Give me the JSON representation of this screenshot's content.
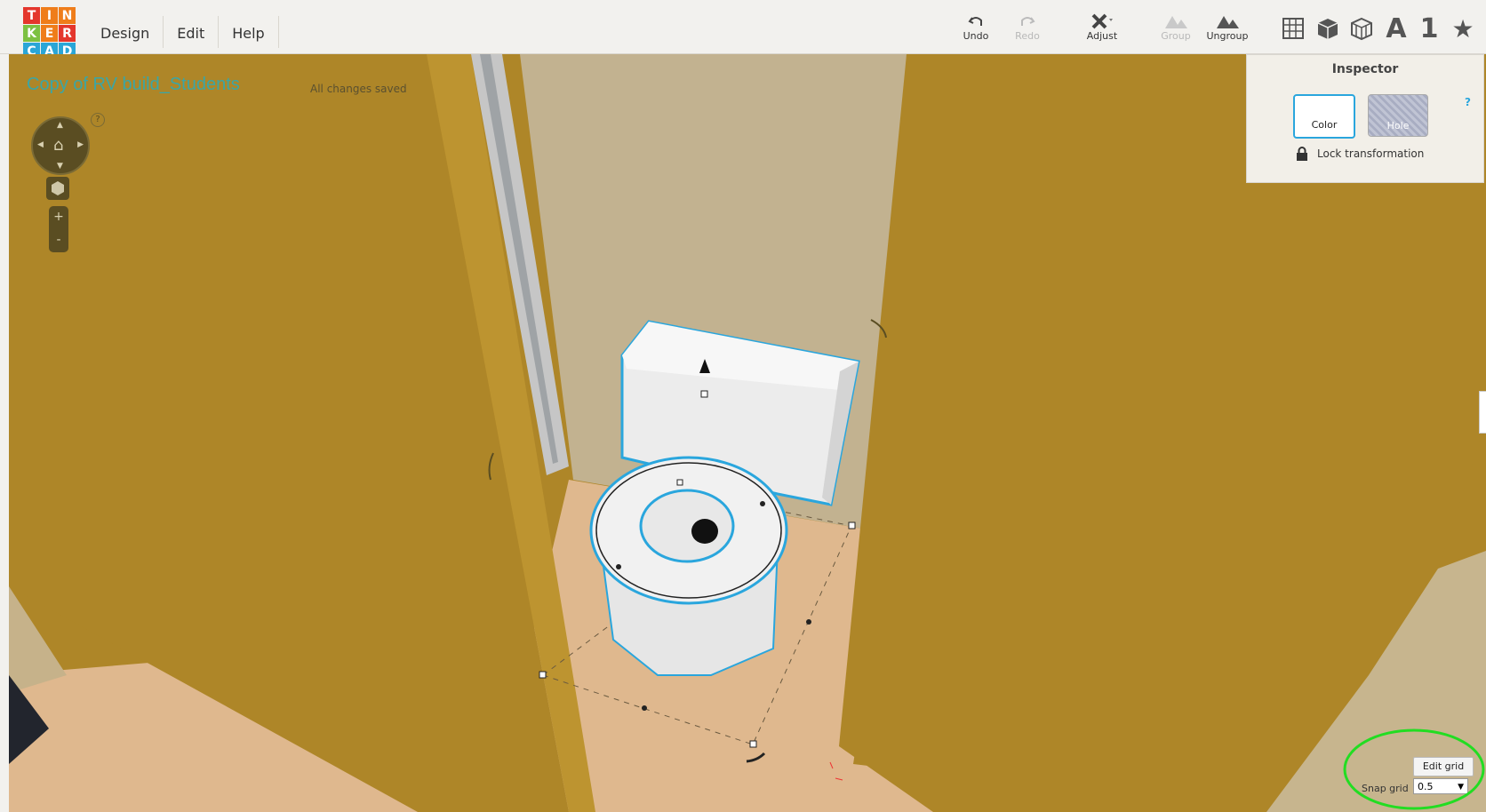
{
  "logo": {
    "letters": [
      "T",
      "I",
      "N",
      "K",
      "E",
      "R",
      "C",
      "A",
      "D"
    ]
  },
  "menu": {
    "design": "Design",
    "edit": "Edit",
    "help": "Help"
  },
  "toolbar": {
    "undo": "Undo",
    "redo": "Redo",
    "adjust": "Adjust",
    "group": "Group",
    "ungroup": "Ungroup"
  },
  "view_icons": {
    "text_label": "A",
    "number_label": "1"
  },
  "project": {
    "title": "Copy of RV build_Students",
    "status": "All changes saved"
  },
  "inspector": {
    "title": "Inspector",
    "color_label": "Color",
    "hole_label": "Hole",
    "help": "?",
    "lock_label": "Lock transformation"
  },
  "nav": {
    "help": "?",
    "zoom_in": "+",
    "zoom_out": "-"
  },
  "grid": {
    "edit_label": "Edit grid",
    "snap_label": "Snap grid",
    "snap_value": "0.5"
  },
  "colors": {
    "wall": "#ae8628",
    "floor": "#dfb88e",
    "selection": "#29a9e0",
    "highlight_ring": "#22dd22",
    "title": "#3aa6a6"
  }
}
